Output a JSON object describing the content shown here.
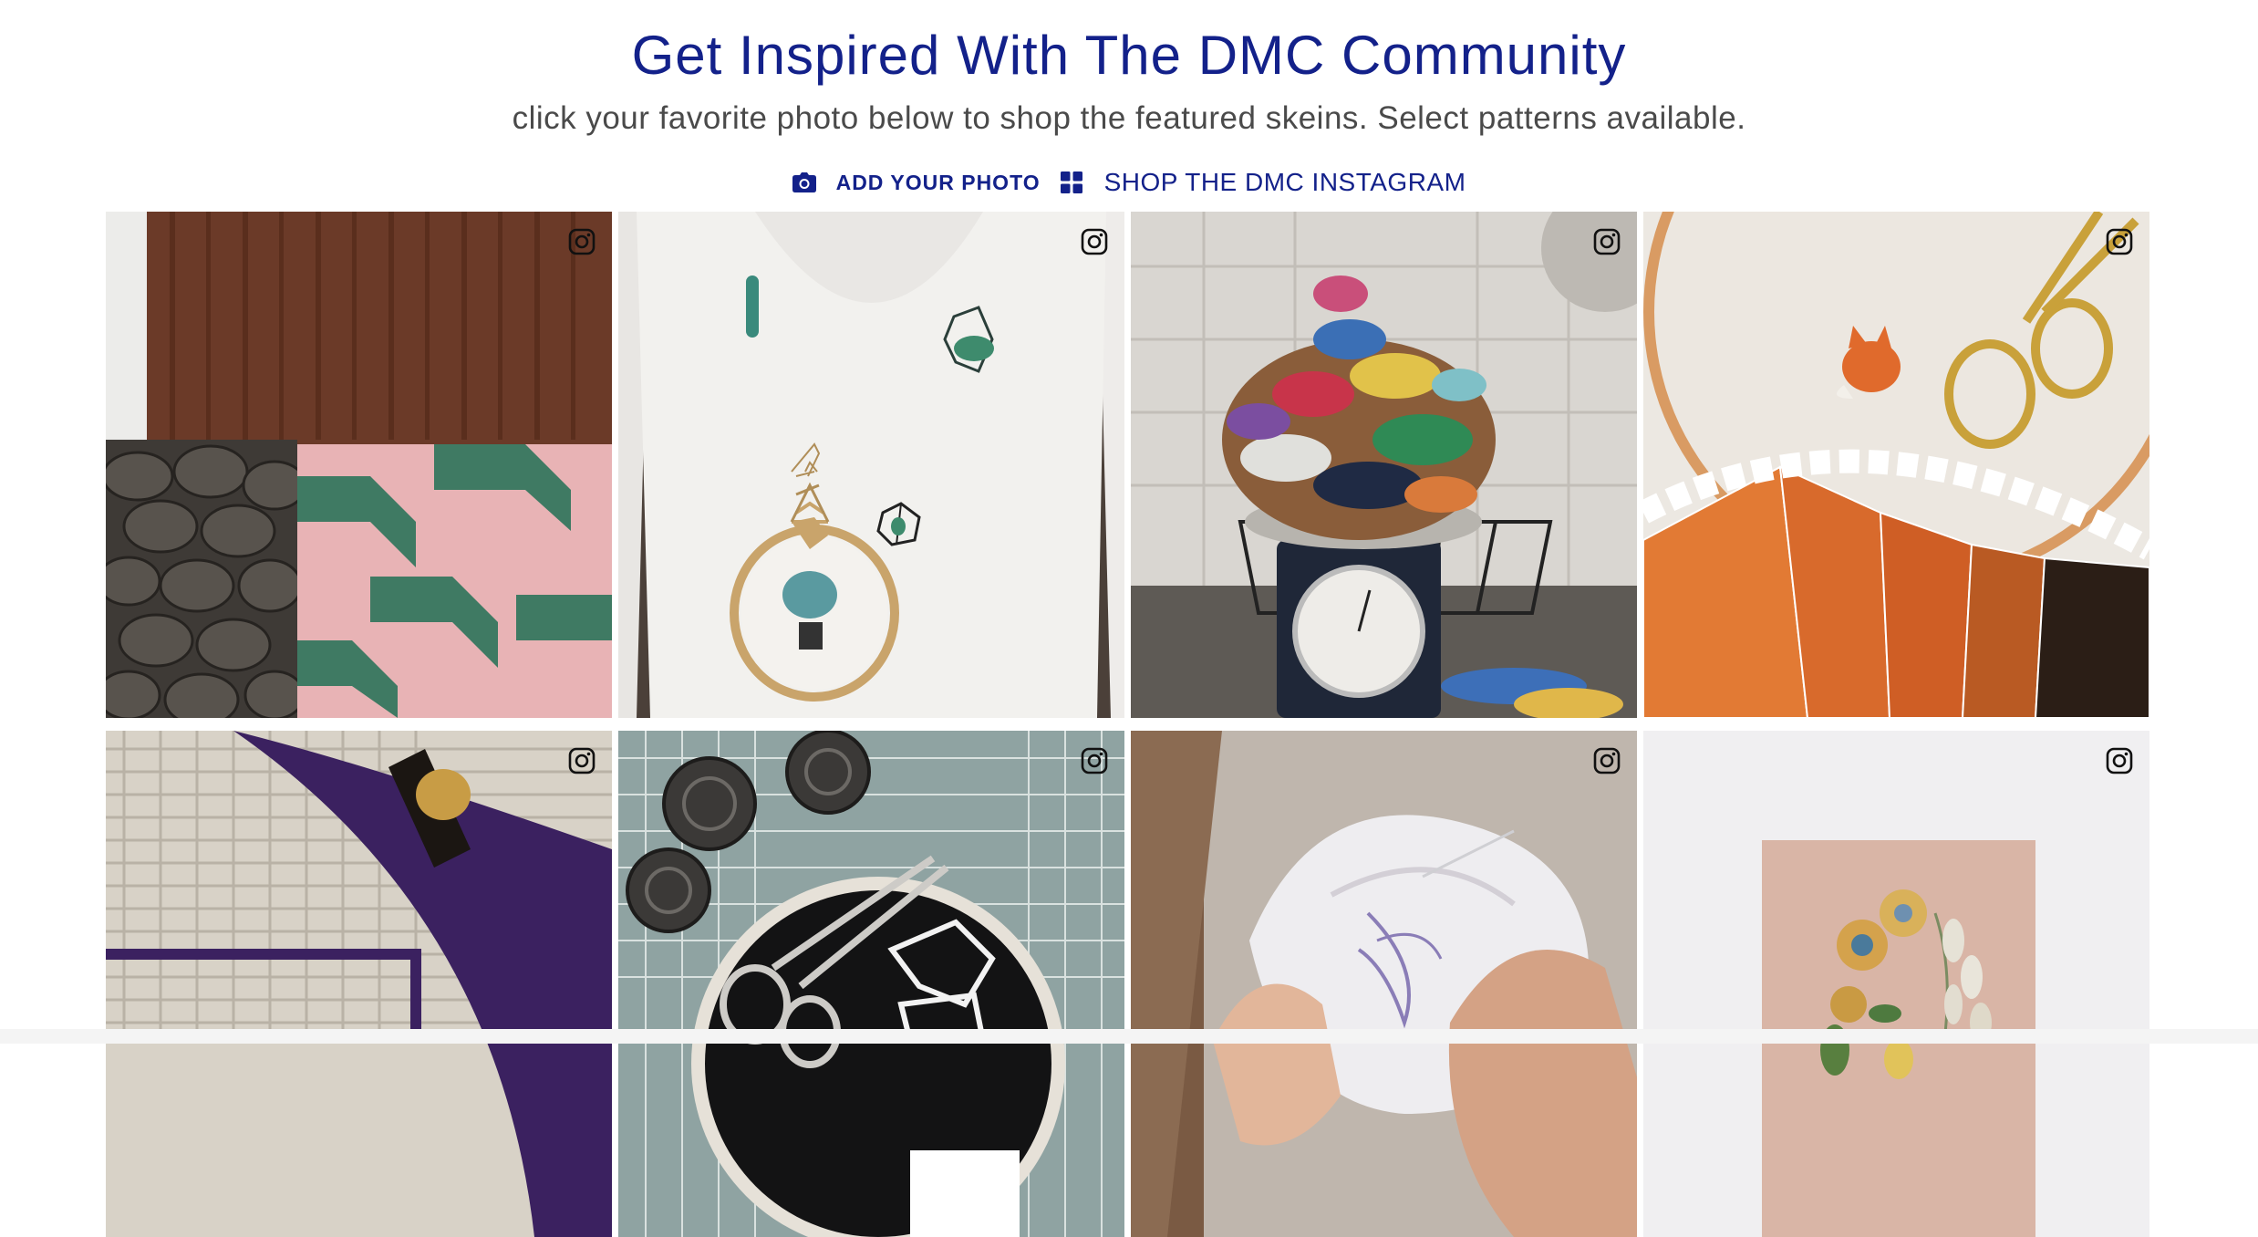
{
  "header": {
    "title": "Get Inspired With The DMC Community",
    "subtitle": "click your favorite photo below to shop the featured skeins. Select patterns available."
  },
  "actions": {
    "add_photo_label": "ADD YOUR PHOTO",
    "add_photo_icon": "camera-icon",
    "shop_instagram_label": "SHOP THE DMC INSTAGRAM",
    "shop_instagram_icon": "grid-icon"
  },
  "colors": {
    "brand_blue": "#13218a",
    "subtitle_gray": "#4a4a4a"
  },
  "gallery": {
    "tile_icon": "instagram-icon",
    "tiles": [
      {
        "subject": "pink-green-knit-blanket"
      },
      {
        "subject": "embroidered-white-tshirt"
      },
      {
        "subject": "floss-skeins-on-scale"
      },
      {
        "subject": "fox-embroidery-hoop"
      },
      {
        "subject": "purple-floss-on-canvas"
      },
      {
        "subject": "cross-stitch-hoop-scissors"
      },
      {
        "subject": "hands-stitching-fabric"
      },
      {
        "subject": "floral-embroidery-card"
      }
    ]
  }
}
